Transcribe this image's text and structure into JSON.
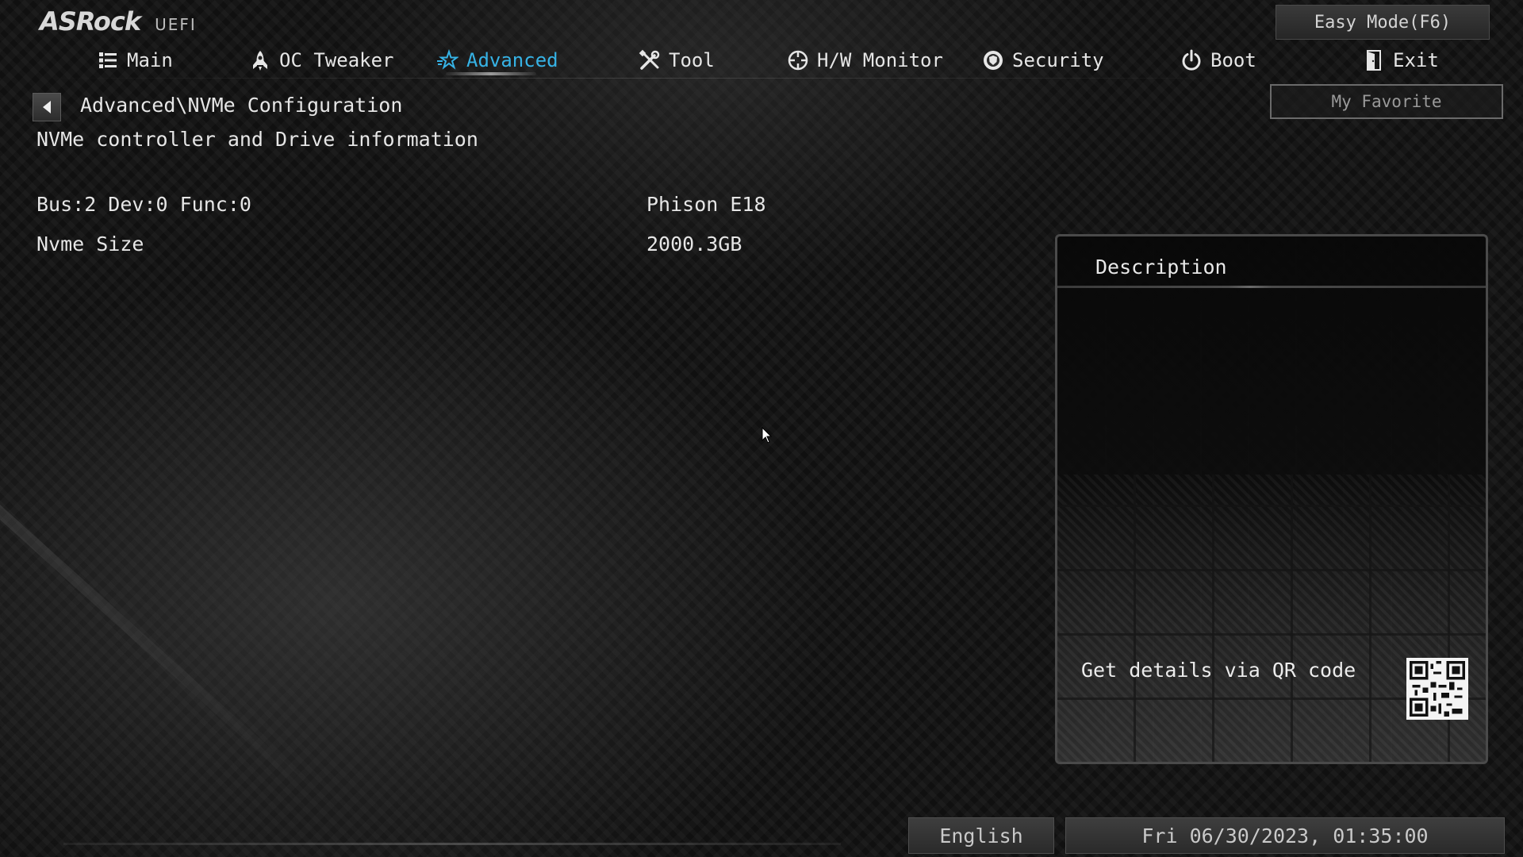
{
  "header": {
    "brand": "ASRock",
    "subtitle": "UEFI",
    "easy_mode_label": "Easy Mode(F6)",
    "my_favorite_label": "My Favorite"
  },
  "nav": {
    "tabs": [
      {
        "label": "Main",
        "icon": "list-icon",
        "active": false
      },
      {
        "label": "OC Tweaker",
        "icon": "rocket-icon",
        "active": false
      },
      {
        "label": "Advanced",
        "icon": "star-icon",
        "active": true
      },
      {
        "label": "Tool",
        "icon": "tools-icon",
        "active": false
      },
      {
        "label": "H/W Monitor",
        "icon": "crosshair-icon",
        "active": false
      },
      {
        "label": "Security",
        "icon": "shield-icon",
        "active": false
      },
      {
        "label": "Boot",
        "icon": "power-icon",
        "active": false
      },
      {
        "label": "Exit",
        "icon": "exit-door-icon",
        "active": false
      }
    ],
    "active_color": "#36b3e6"
  },
  "page": {
    "breadcrumb": "Advanced\\NVMe Configuration",
    "section_title": "NVMe controller and Drive information",
    "rows": [
      {
        "label": "Bus:2 Dev:0 Func:0",
        "value": "Phison E18"
      },
      {
        "label": "Nvme Size",
        "value": "2000.3GB"
      }
    ]
  },
  "description": {
    "title": "Description",
    "qr_text": "Get details via QR code"
  },
  "footer": {
    "language": "English",
    "datetime": "Fri 06/30/2023, 01:35:00"
  }
}
